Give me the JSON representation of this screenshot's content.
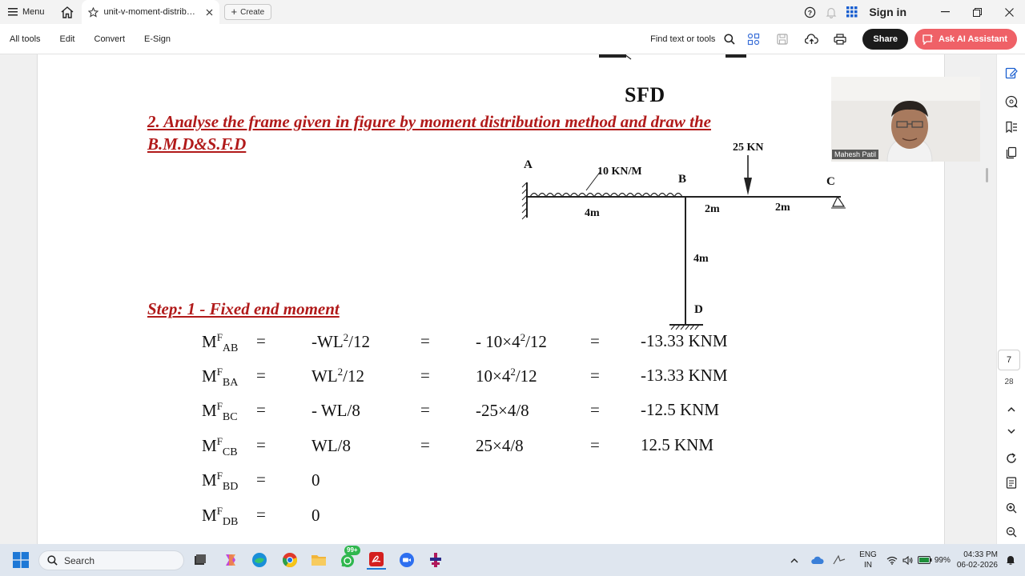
{
  "titlebar": {
    "menu_label": "Menu",
    "tab_title": "unit-v-moment-distribut...",
    "create_label": "Create",
    "sign_in": "Sign in"
  },
  "toolbar": {
    "items": [
      "All tools",
      "Edit",
      "Convert",
      "E-Sign"
    ],
    "find_text": "Find text or tools",
    "share_label": "Share",
    "ai_label": "Ask AI Assistant"
  },
  "document": {
    "sfd_title": "SFD",
    "question_line1": "2.  Analyse the frame given in figure by moment distribution method and draw the",
    "question_line2": "B.M.D&S.F.D",
    "step_heading": "Step: 1 - Fixed end moment",
    "diagram": {
      "label_a": "A",
      "label_b": "B",
      "label_c": "C",
      "label_d": "D",
      "udl_label": "10 KN/M",
      "point_load": "25 KN",
      "span_ab": "4m",
      "span_b_load": "2m",
      "span_load_c": "2m",
      "span_bd": "4m"
    },
    "equations": [
      {
        "m": "M",
        "sup": "F",
        "sub": "AB",
        "eq1": "=",
        "formula_pre": "-WL",
        "formula_sup": "2",
        "formula_post": "/12",
        "eq2": "=",
        "calc_pre": "- 10×4",
        "calc_sup": "2",
        "calc_post": "/12",
        "eq3": "=",
        "result": "-13.33 KNM"
      },
      {
        "m": "M",
        "sup": "F",
        "sub": "BA",
        "eq1": "=",
        "formula_pre": "WL",
        "formula_sup": "2",
        "formula_post": "/12",
        "eq2": "=",
        "calc_pre": "10×4",
        "calc_sup": "2",
        "calc_post": "/12",
        "eq3": "=",
        "result": "-13.33 KNM"
      },
      {
        "m": "M",
        "sup": "F",
        "sub": "BC",
        "eq1": "=",
        "formula_pre": "- WL/8",
        "formula_sup": "",
        "formula_post": "",
        "eq2": "=",
        "calc_pre": "-25×4/8",
        "calc_sup": "",
        "calc_post": "",
        "eq3": "=",
        "result": "-12.5 KNM"
      },
      {
        "m": "M",
        "sup": "F",
        "sub": "CB",
        "eq1": "=",
        "formula_pre": "WL/8",
        "formula_sup": "",
        "formula_post": "",
        "eq2": "=",
        "calc_pre": "25×4/8",
        "calc_sup": "",
        "calc_post": "",
        "eq3": "=",
        "result": "12.5 KNM"
      },
      {
        "m": "M",
        "sup": "F",
        "sub": "BD",
        "eq1": "=",
        "formula_pre": "0",
        "formula_sup": "",
        "formula_post": "",
        "eq2": "",
        "calc_pre": "",
        "calc_sup": "",
        "calc_post": "",
        "eq3": "",
        "result": ""
      },
      {
        "m": "M",
        "sup": "F",
        "sub": "DB",
        "eq1": "=",
        "formula_pre": "0",
        "formula_sup": "",
        "formula_post": "",
        "eq2": "",
        "calc_pre": "",
        "calc_sup": "",
        "calc_post": "",
        "eq3": "",
        "result": ""
      }
    ]
  },
  "video": {
    "participant_name": "Mahesh Patil"
  },
  "navigation": {
    "current_page": "7",
    "total_pages": "28"
  },
  "taskbar": {
    "search_placeholder": "Search",
    "badge": "99+",
    "lang_line1": "ENG",
    "lang_line2": "IN",
    "battery": "99%",
    "time": "04:33 PM",
    "date": "06-02-2026"
  },
  "colors": {
    "heading_red": "#b11a1a",
    "ai_button": "#ef6167",
    "share_button": "#1b1b1b"
  }
}
